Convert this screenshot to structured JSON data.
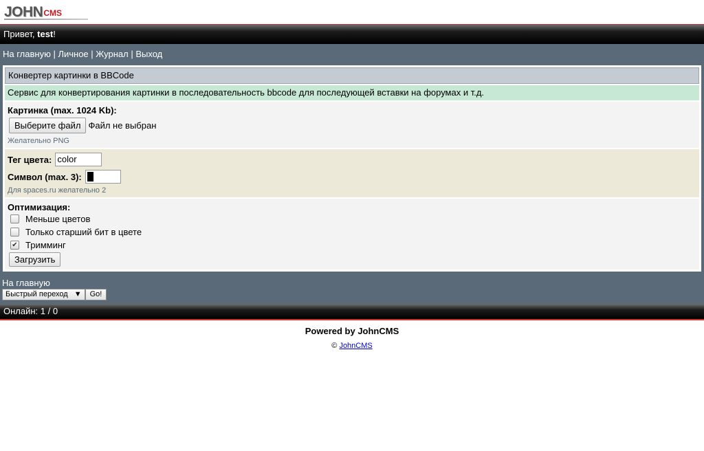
{
  "logo": {
    "john": "JOHN",
    "cms": "CMS"
  },
  "header": {
    "greeting": "Привет, ",
    "username": "test",
    "exclaim": "!"
  },
  "nav": {
    "home": "На главную",
    "personal": "Личное",
    "journal": "Журнал",
    "logout": "Выход",
    "sep": " | "
  },
  "panel": {
    "title": "Конвертер картинки в BBCode",
    "note": "Сервис для конвертирования картинки в последовательность bbcode для последующей вставки на форумах и т.д.",
    "image_label": "Картинка (max. 1024 Kb):",
    "file_button": "Выберите файл",
    "file_status": "Файл не выбран",
    "image_hint": "Желательно PNG",
    "color_tag_label": "Тег цвета:",
    "color_tag_value": "color",
    "symbol_label": "Символ (max. 3):",
    "symbol_hint": "Для spaces.ru желательно 2",
    "opt_label": "Оптимизация:",
    "options": [
      {
        "label": "Меньше цветов",
        "checked": false
      },
      {
        "label": "Только старший бит в цвете",
        "checked": false
      },
      {
        "label": "Тримминг",
        "checked": true
      }
    ],
    "submit": "Загрузить"
  },
  "footer": {
    "home": "На главную",
    "quick_nav": "Быстрый переход",
    "go": "Go!",
    "online": "Онлайн: 1 / 0",
    "powered": "Powered by JohnCMS",
    "copy_symbol": "©",
    "copy_link": "JohnCMS"
  }
}
